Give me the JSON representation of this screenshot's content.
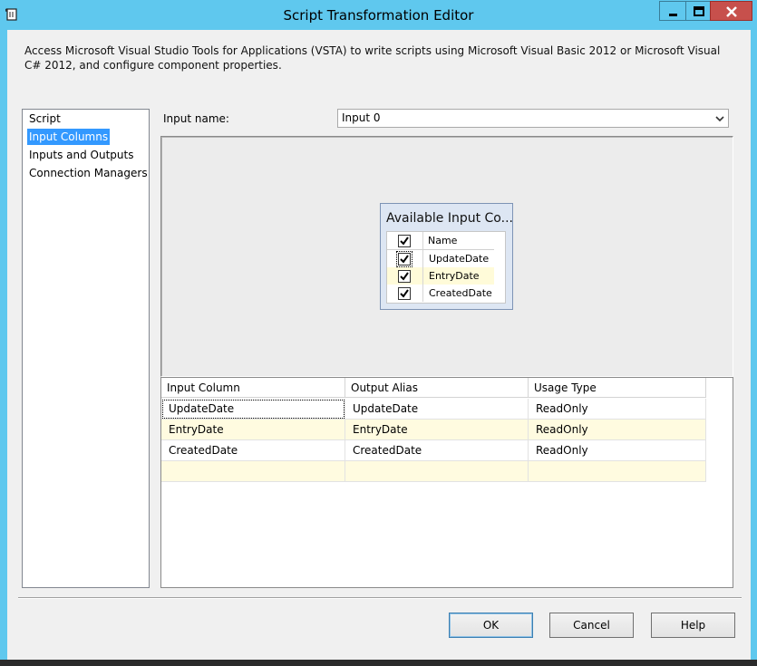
{
  "window": {
    "title": "Script Transformation Editor",
    "icon": "script-icon",
    "controls": [
      "minimize-icon",
      "maximize-icon",
      "close-icon"
    ]
  },
  "description": "Access Microsoft Visual Studio Tools for Applications (VSTA) to write scripts using Microsoft Visual Basic 2012 or Microsoft Visual C# 2012, and configure component properties.",
  "nav": {
    "items": [
      "Script",
      "Input Columns",
      "Inputs and Outputs",
      "Connection Managers"
    ],
    "selected": "Input Columns"
  },
  "input": {
    "label": "Input name:",
    "value": "Input 0"
  },
  "available": {
    "title": "Available Input Co...",
    "header": "Name",
    "columns": [
      {
        "name": "UpdateDate",
        "checked": true
      },
      {
        "name": "EntryDate",
        "checked": true
      },
      {
        "name": "CreatedDate",
        "checked": true
      }
    ]
  },
  "grid": {
    "headers": [
      "Input Column",
      "Output Alias",
      "Usage Type"
    ],
    "rows": [
      [
        "UpdateDate",
        "UpdateDate",
        "ReadOnly"
      ],
      [
        "EntryDate",
        "EntryDate",
        "ReadOnly"
      ],
      [
        "CreatedDate",
        "CreatedDate",
        "ReadOnly"
      ]
    ]
  },
  "buttons": {
    "ok": "OK",
    "cancel": "Cancel",
    "help": "Help"
  },
  "colors": {
    "titlebar": "#5fc8ee",
    "close": "#c7504c",
    "selection": "#3399ff"
  }
}
